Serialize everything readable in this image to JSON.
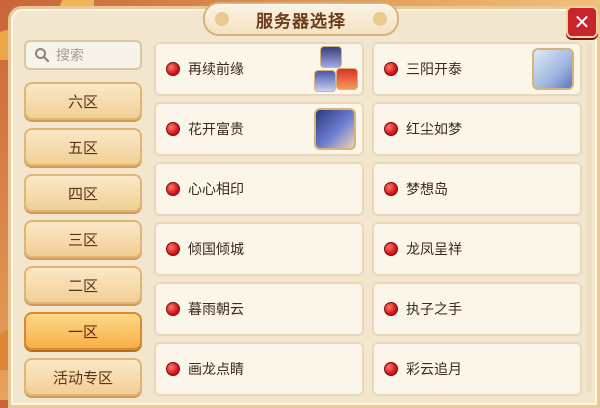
{
  "window": {
    "title": "服务器选择"
  },
  "search": {
    "placeholder": "搜索"
  },
  "zones": [
    {
      "label": "六区",
      "active": false
    },
    {
      "label": "五区",
      "active": false
    },
    {
      "label": "四区",
      "active": false
    },
    {
      "label": "三区",
      "active": false
    },
    {
      "label": "二区",
      "active": false
    },
    {
      "label": "一区",
      "active": true
    },
    {
      "label": "活动专区",
      "active": false
    }
  ],
  "servers": [
    {
      "name": "再续前缘",
      "status": "busy",
      "avatar": "two-characters"
    },
    {
      "name": "三阳开泰",
      "status": "busy",
      "avatar": "white-hair-character"
    },
    {
      "name": "花开富贵",
      "status": "busy",
      "avatar": "blue-hair-character"
    },
    {
      "name": "红尘如梦",
      "status": "busy",
      "avatar": null
    },
    {
      "name": "心心相印",
      "status": "busy",
      "avatar": null
    },
    {
      "name": "梦想岛",
      "status": "busy",
      "avatar": null
    },
    {
      "name": "倾国倾城",
      "status": "busy",
      "avatar": null
    },
    {
      "name": "龙凤呈祥",
      "status": "busy",
      "avatar": null
    },
    {
      "name": "暮雨朝云",
      "status": "busy",
      "avatar": null
    },
    {
      "name": "执子之手",
      "status": "busy",
      "avatar": null
    },
    {
      "name": "画龙点睛",
      "status": "busy",
      "avatar": null
    },
    {
      "name": "彩云追月",
      "status": "busy",
      "avatar": null
    }
  ],
  "colors": {
    "status_dot": "#d4141b",
    "active_zone": "#f6b048",
    "close_button": "#c9232b"
  },
  "icons": {
    "close": "close-icon",
    "search": "search-icon"
  }
}
